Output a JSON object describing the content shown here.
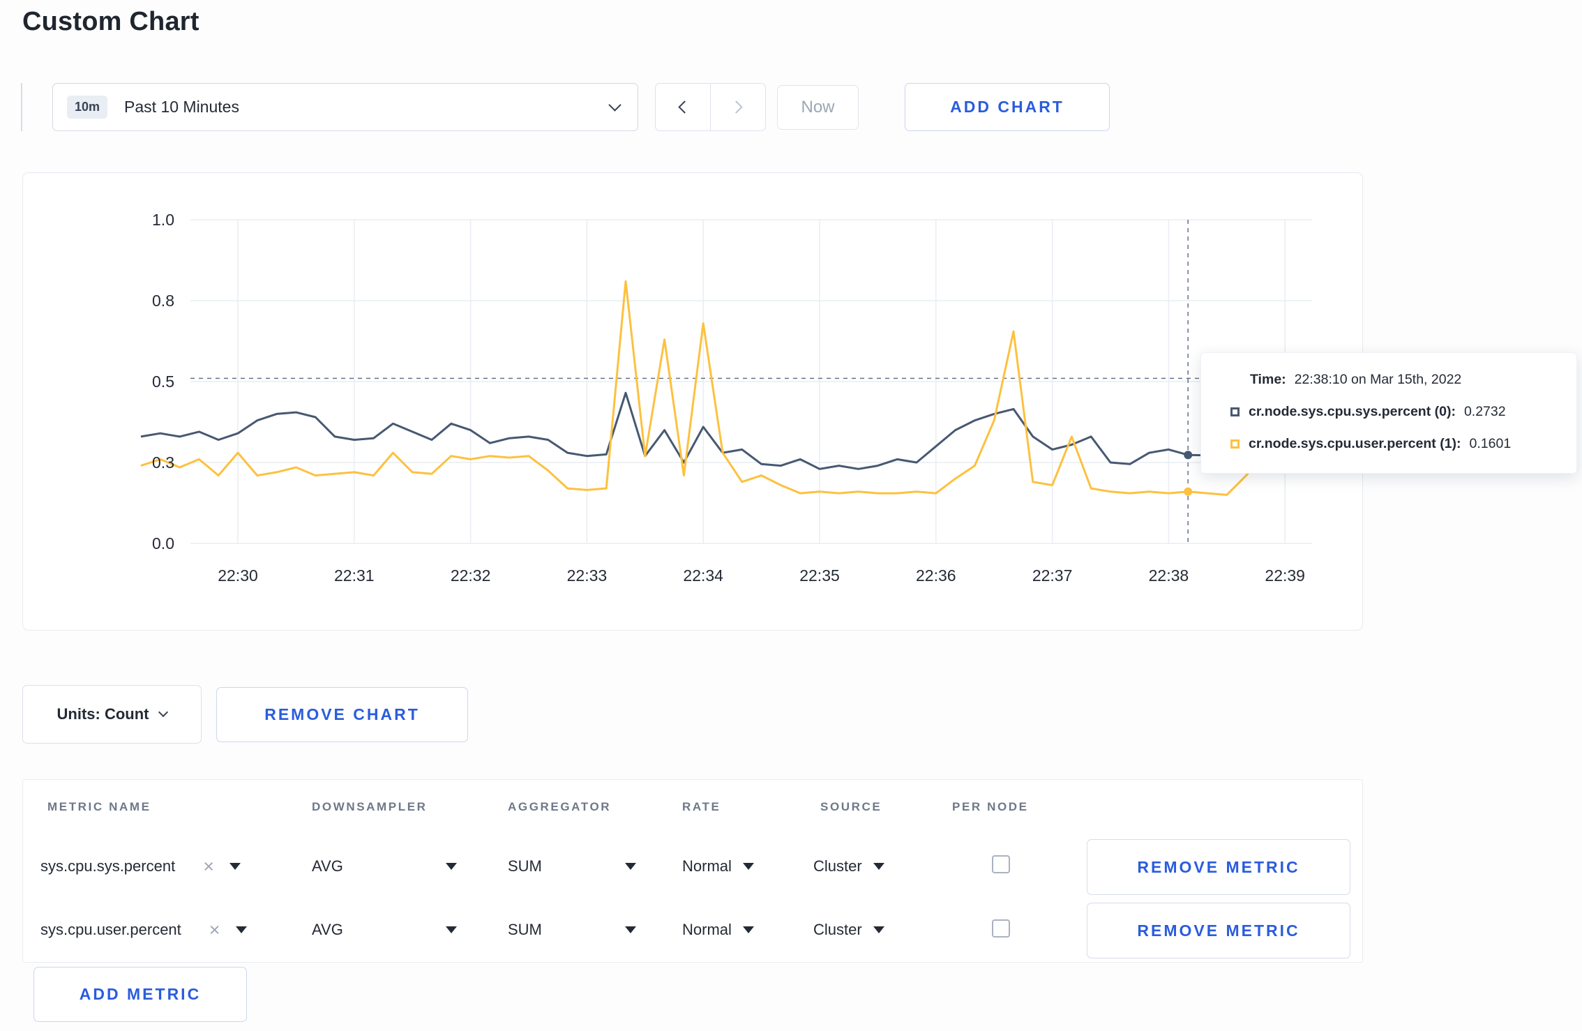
{
  "page": {
    "title": "Custom Chart"
  },
  "toolbar": {
    "time_badge": "10m",
    "time_label": "Past 10 Minutes",
    "now_label": "Now",
    "add_chart_label": "ADD CHART"
  },
  "icons": {
    "clear": "×"
  },
  "colors": {
    "accent_blue": "#2a5cdd",
    "grid": "#e9edf2",
    "crosshair": "#64718a",
    "series_sys": "#475872",
    "series_user": "#fdc13f"
  },
  "chart_data": {
    "type": "line",
    "title": "",
    "ylim": [
      0,
      1
    ],
    "grid": true,
    "y_ticks": [
      "0.0",
      "0.3",
      "0.5",
      "0.8",
      "1.0"
    ],
    "y_tick_values": [
      0,
      0.25,
      0.5,
      0.75,
      1.0
    ],
    "x_ticks": [
      "22:30",
      "22:31",
      "22:32",
      "22:33",
      "22:34",
      "22:35",
      "22:36",
      "22:37",
      "22:38",
      "22:39"
    ],
    "x_start": "22:29:10",
    "x_interval_seconds": 10,
    "crosshair": {
      "x_index": 54,
      "time": "22:38:10",
      "y_value": 0.51
    },
    "series": [
      {
        "name": "cr.node.sys.cpu.sys.percent",
        "color": "#475872",
        "values": [
          0.33,
          0.34,
          0.33,
          0.345,
          0.32,
          0.34,
          0.38,
          0.4,
          0.405,
          0.39,
          0.33,
          0.32,
          0.325,
          0.37,
          0.345,
          0.32,
          0.37,
          0.35,
          0.31,
          0.325,
          0.33,
          0.32,
          0.28,
          0.27,
          0.275,
          0.465,
          0.27,
          0.35,
          0.25,
          0.36,
          0.28,
          0.29,
          0.245,
          0.24,
          0.26,
          0.23,
          0.24,
          0.23,
          0.24,
          0.26,
          0.25,
          0.3,
          0.35,
          0.38,
          0.4,
          0.415,
          0.33,
          0.29,
          0.305,
          0.33,
          0.25,
          0.245,
          0.28,
          0.29,
          0.2732,
          0.272,
          0.27,
          0.26,
          0.27,
          0.275,
          0.33
        ]
      },
      {
        "name": "cr.node.sys.cpu.user.percent",
        "color": "#fdc13f",
        "values": [
          0.24,
          0.26,
          0.235,
          0.26,
          0.21,
          0.28,
          0.21,
          0.22,
          0.235,
          0.21,
          0.215,
          0.22,
          0.21,
          0.28,
          0.22,
          0.215,
          0.27,
          0.26,
          0.27,
          0.265,
          0.27,
          0.225,
          0.17,
          0.165,
          0.17,
          0.81,
          0.27,
          0.63,
          0.21,
          0.68,
          0.28,
          0.19,
          0.21,
          0.18,
          0.155,
          0.16,
          0.155,
          0.16,
          0.155,
          0.155,
          0.16,
          0.155,
          0.2,
          0.24,
          0.38,
          0.655,
          0.19,
          0.18,
          0.33,
          0.17,
          0.16,
          0.155,
          0.16,
          0.155,
          0.1601,
          0.155,
          0.15,
          0.21,
          0.28,
          0.245,
          0.28
        ]
      }
    ]
  },
  "tooltip": {
    "time_label": "Time:",
    "time_value": "22:38:10 on Mar 15th, 2022",
    "rows": [
      {
        "label": "cr.node.sys.cpu.sys.percent (0):",
        "value": "0.2732",
        "color": "#475872"
      },
      {
        "label": "cr.node.sys.cpu.user.percent (1):",
        "value": "0.1601",
        "color": "#fdc13f"
      }
    ]
  },
  "chart_controls": {
    "units_label": "Units: Count",
    "remove_chart_label": "REMOVE CHART"
  },
  "metrics_table": {
    "headers": [
      "METRIC NAME",
      "DOWNSAMPLER",
      "AGGREGATOR",
      "RATE",
      "SOURCE",
      "PER NODE"
    ],
    "rows": [
      {
        "metric": "sys.cpu.sys.percent",
        "downsampler": "AVG",
        "aggregator": "SUM",
        "rate": "Normal",
        "source": "Cluster",
        "per_node": false,
        "remove_label": "REMOVE METRIC"
      },
      {
        "metric": "sys.cpu.user.percent",
        "downsampler": "AVG",
        "aggregator": "SUM",
        "rate": "Normal",
        "source": "Cluster",
        "per_node": false,
        "remove_label": "REMOVE METRIC"
      }
    ],
    "add_metric_label": "ADD METRIC"
  }
}
